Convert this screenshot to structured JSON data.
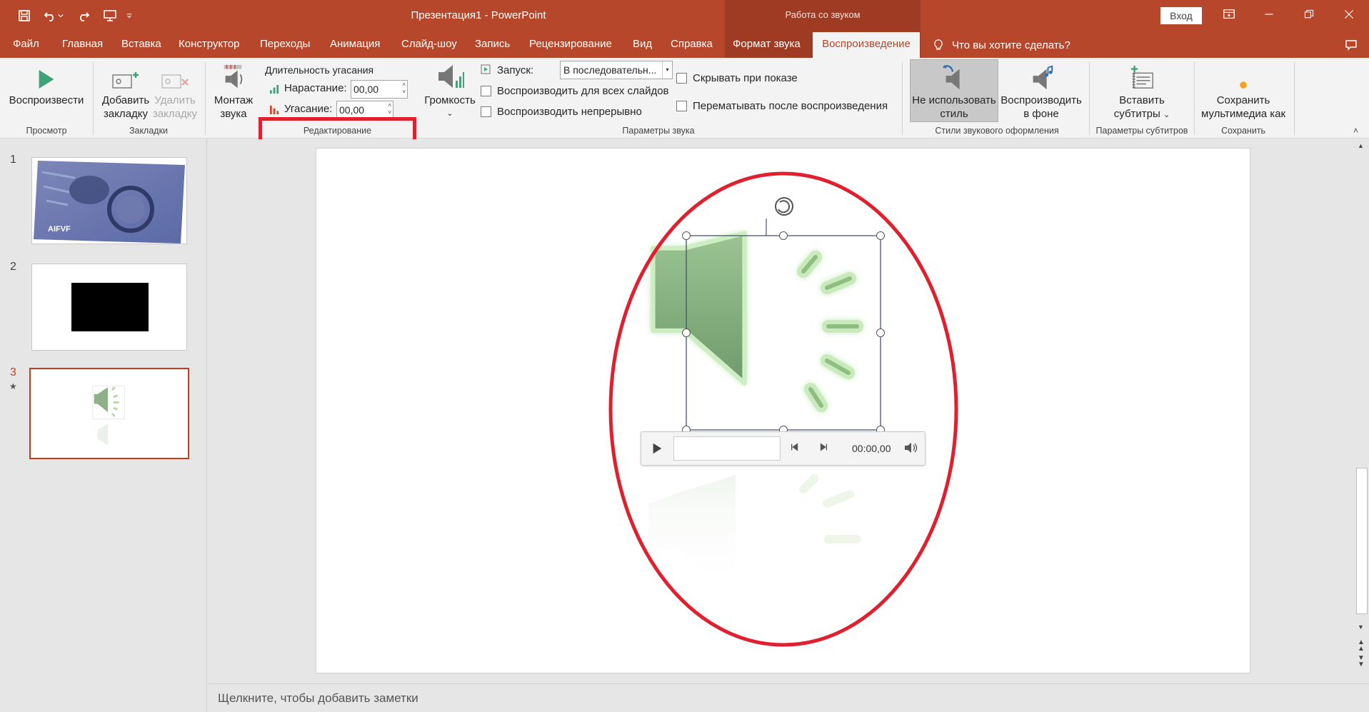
{
  "titlebar": {
    "doc_title": "Презентация1  -  PowerPoint",
    "context_title": "Работа со звуком",
    "signin": "Вход"
  },
  "tabs": {
    "file": "Файл",
    "home": "Главная",
    "insert": "Вставка",
    "design": "Конструктор",
    "transitions": "Переходы",
    "animations": "Анимация",
    "slideshow": "Слайд-шоу",
    "record": "Запись",
    "review": "Рецензирование",
    "view": "Вид",
    "help": "Справка",
    "audio_format": "Формат звука",
    "playback": "Воспроизведение",
    "tell_me": "Что вы хотите сделать?"
  },
  "ribbon": {
    "play_label": "Воспроизвести",
    "group_preview": "Просмотр",
    "add_bookmark_1": "Добавить",
    "add_bookmark_2": "закладку",
    "remove_bookmark_1": "Удалить",
    "remove_bookmark_2": "закладку",
    "group_bookmarks": "Закладки",
    "trim_1": "Монтаж",
    "trim_2": "звука",
    "fade_title": "Длительность угасания",
    "fade_in_label": "Нарастание:",
    "fade_in_value": "00,00",
    "fade_out_label": "Угасание:",
    "fade_out_value": "00,00",
    "group_editing": "Редактирование",
    "volume_label": "Громкость",
    "start_label": "Запуск:",
    "start_value": "В последовательн...",
    "play_all_slides": "Воспроизводить для всех слайдов",
    "loop": "Воспроизводить непрерывно",
    "hide_during_show": "Скрывать при показе",
    "rewind_after": "Перематывать после воспроизведения",
    "group_audio_options": "Параметры звука",
    "no_style_1": "Не использовать",
    "no_style_2": "стиль",
    "play_bg_1": "Воспроизводить",
    "play_bg_2": "в фоне",
    "group_audio_styles": "Стили звукового оформления",
    "insert_captions_1": "Вставить",
    "insert_captions_2": "субтитры",
    "group_captions": "Параметры субтитров",
    "save_media_1": "Сохранить",
    "save_media_2": "мультимедиа как",
    "group_save": "Сохранить"
  },
  "slides": {
    "numbers": [
      "1",
      "2",
      "3"
    ],
    "thumb1_caption": "AIFVF"
  },
  "player": {
    "time": "00:00,00"
  },
  "notes": {
    "placeholder": "Щелкните, чтобы добавить заметки"
  },
  "colors": {
    "brand": "#b7472a",
    "context_band": "#9e3b22",
    "highlight_red": "#e0202f",
    "speaker_green": "#8eb088"
  }
}
